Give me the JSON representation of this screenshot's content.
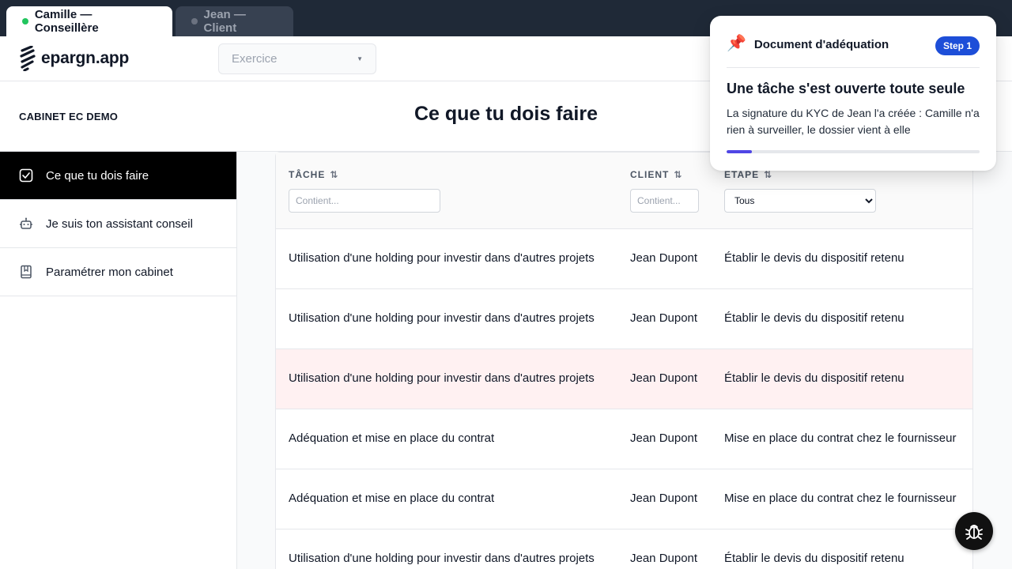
{
  "tabs": [
    {
      "label": "Camille — Conseillère",
      "dot_color": "#22c55e",
      "active": true
    },
    {
      "label": "Jean — Client",
      "dot_color": "#6b7280",
      "active": false
    }
  ],
  "header": {
    "logo_text": "epargn.app",
    "exercice_placeholder": "Exercice"
  },
  "titleband": {
    "cabinet": "CABINET EC DEMO",
    "page_title": "Ce que tu dois faire"
  },
  "sidebar": {
    "items": [
      {
        "label": "Ce que tu dois faire",
        "icon": "checkbox-icon"
      },
      {
        "label": "Je suis ton assistant conseil",
        "icon": "robot-icon"
      },
      {
        "label": "Paramétrer mon cabinet",
        "icon": "book-icon"
      }
    ]
  },
  "table": {
    "columns": {
      "tache": "TÂCHE",
      "client": "CLIENT",
      "etape": "ETAPE"
    },
    "filters": {
      "tache_placeholder": "Contient...",
      "client_placeholder": "Contient...",
      "etape_selected": "Tous"
    },
    "rows": [
      {
        "tache": "Utilisation d'une holding pour investir dans d'autres projets",
        "client": "Jean Dupont",
        "etape": "Établir le devis du dispositif retenu"
      },
      {
        "tache": "Utilisation d'une holding pour investir dans d'autres projets",
        "client": "Jean Dupont",
        "etape": "Établir le devis du dispositif retenu"
      },
      {
        "tache": "Utilisation d'une holding pour investir dans d'autres projets",
        "client": "Jean Dupont",
        "etape": "Établir le devis du dispositif retenu"
      },
      {
        "tache": "Adéquation et mise en place du contrat",
        "client": "Jean Dupont",
        "etape": "Mise en place du contrat chez le fournisseur"
      },
      {
        "tache": "Adéquation et mise en place du contrat",
        "client": "Jean Dupont",
        "etape": "Mise en place du contrat chez le fournisseur"
      },
      {
        "tache": "Utilisation d'une holding pour investir dans d'autres projets",
        "client": "Jean Dupont",
        "etape": "Établir le devis du dispositif retenu"
      }
    ],
    "highlight_color": "#fff1f2"
  },
  "popover": {
    "label": "Document d'adéquation",
    "step": "Step 1",
    "title": "Une tâche s'est ouverte toute seule",
    "body": "La signature du KYC de Jean l'a créée : Camille n'a rien à surveiller, le dossier vient à elle",
    "progress_fraction": 0.1,
    "accent": "#1d4ed8"
  },
  "fab": {
    "icon": "bug-icon"
  }
}
